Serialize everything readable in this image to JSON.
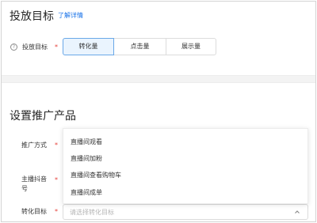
{
  "section_target": {
    "title": "投放目标",
    "detail_link": "了解详情",
    "field_label": "投放目标",
    "required_mark": "*",
    "help_icon": "help-circle-icon",
    "options": [
      {
        "label": "转化量",
        "selected": true
      },
      {
        "label": "点击量",
        "selected": false
      },
      {
        "label": "展示量",
        "selected": false
      }
    ]
  },
  "section_product": {
    "title": "设置推广产品",
    "method_label": "推广方式",
    "account_label": "主播抖音号",
    "conversion_label": "转化目标",
    "required_mark": "*",
    "dropdown_options": [
      "直播间观看",
      "直播间加粉",
      "直播间查看购物车",
      "直播间成单"
    ],
    "conversion_select": {
      "value": "",
      "placeholder": "请选择转化目标",
      "expanded": true,
      "icon": "chevron-up-icon"
    }
  },
  "colors": {
    "accent": "#1a73e8",
    "required": "#e6413a",
    "selected_bg": "#eaf4fe",
    "selected_border": "#6aa8e8"
  }
}
